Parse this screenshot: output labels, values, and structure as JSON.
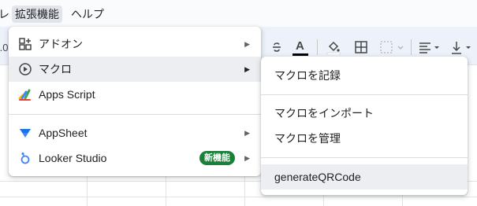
{
  "menubar": {
    "left_fragment": "レ",
    "extensions": "拡張機能",
    "help": "ヘルプ"
  },
  "toolbar": {
    "left_fragment": ".0",
    "font_color_letter": "A"
  },
  "main_menu": {
    "items": [
      {
        "label": "アドオン",
        "icon": "addon-icon",
        "has_submenu": true
      },
      {
        "label": "マクロ",
        "icon": "play-circle-icon",
        "has_submenu": true
      },
      {
        "label": "Apps Script",
        "icon": "apps-script-icon",
        "has_submenu": false
      },
      {
        "label": "AppSheet",
        "icon": "appsheet-icon",
        "has_submenu": true
      },
      {
        "label": "Looker Studio",
        "icon": "looker-studio-icon",
        "has_submenu": true,
        "badge": "新機能"
      }
    ]
  },
  "macro_submenu": {
    "items": [
      {
        "label": "マクロを記録"
      },
      {
        "label": "マクロをインポート"
      },
      {
        "label": "マクロを管理"
      },
      {
        "label": "generateQRCode"
      }
    ]
  },
  "colors": {
    "badge_green": "#188038",
    "hover_bg": "#eceef1",
    "font_color_bar": "#000000"
  }
}
